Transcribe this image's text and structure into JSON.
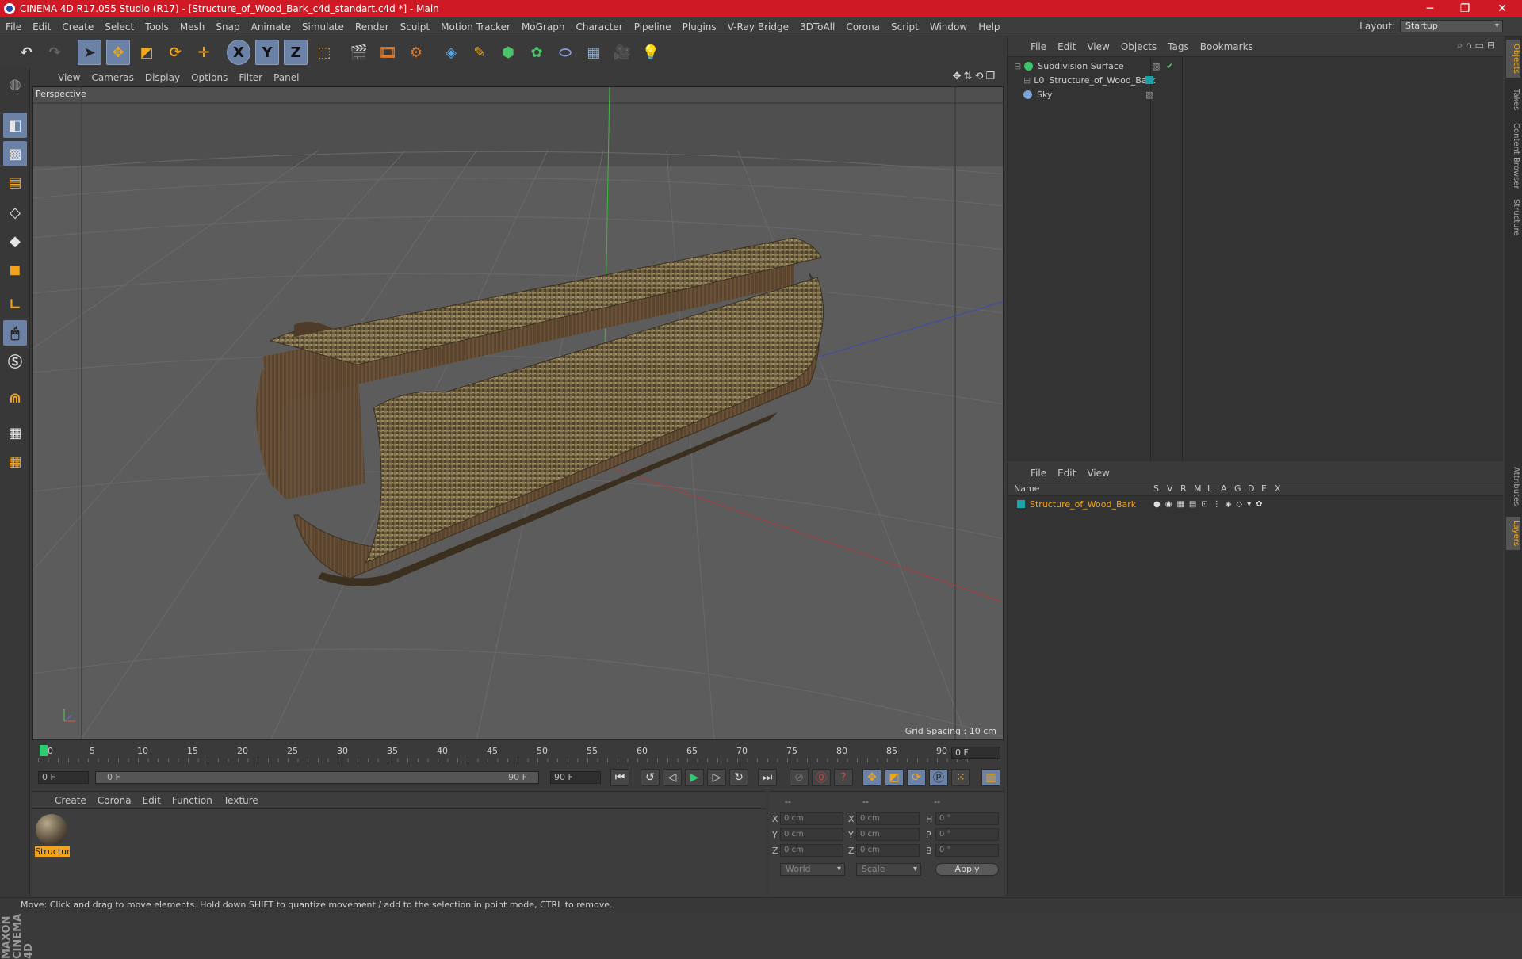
{
  "window": {
    "title": "CINEMA 4D R17.055 Studio (R17) - [Structure_of_Wood_Bark_c4d_standart.c4d *] - Main",
    "minimize": "─",
    "maximize": "❐",
    "close": "✕"
  },
  "menubar": {
    "items": [
      "File",
      "Edit",
      "Create",
      "Select",
      "Tools",
      "Mesh",
      "Snap",
      "Animate",
      "Simulate",
      "Render",
      "Sculpt",
      "Motion Tracker",
      "MoGraph",
      "Character",
      "Pipeline",
      "Plugins",
      "V-Ray Bridge",
      "3DToAll",
      "Corona",
      "Script",
      "Window",
      "Help"
    ],
    "layout_label": "Layout:",
    "layout_value": "Startup"
  },
  "toolbar": {
    "icons": [
      "undo-icon",
      "redo-icon",
      "select-arrow-icon",
      "move-icon",
      "scale-icon",
      "rotate-icon",
      "live-select-icon",
      "x-axis-icon",
      "y-axis-icon",
      "z-axis-icon",
      "coordinate-system-icon",
      "render-view-icon",
      "render-picture-viewer-icon",
      "render-settings-icon",
      "cube-icon",
      "pen-spline-icon",
      "subdivision-icon",
      "cloner-icon",
      "deformer-icon",
      "floor-icon",
      "camera-icon",
      "light-icon"
    ],
    "x_label": "X",
    "y_label": "Y",
    "z_label": "Z"
  },
  "viewport": {
    "menu": [
      "View",
      "Cameras",
      "Display",
      "Options",
      "Filter",
      "Panel"
    ],
    "label": "Perspective",
    "grid_spacing": "Grid Spacing : 10 cm"
  },
  "timeline": {
    "ticks": [
      "0",
      "5",
      "10",
      "15",
      "20",
      "25",
      "30",
      "35",
      "40",
      "45",
      "50",
      "55",
      "60",
      "65",
      "70",
      "75",
      "80",
      "85",
      "90"
    ],
    "current_frame": "0 F",
    "start": "0 F",
    "slider_start": "0 F",
    "slider_end": "90 F",
    "end": "90 F"
  },
  "material_manager": {
    "menu": [
      "Create",
      "Corona",
      "Edit",
      "Function",
      "Texture"
    ],
    "material_name": "Structur"
  },
  "coordinates": {
    "headers": [
      "--",
      "--",
      "--"
    ],
    "rows": [
      {
        "a": "X",
        "av": "0 cm",
        "b": "X",
        "bv": "0 cm",
        "c": "H",
        "cv": "0 °"
      },
      {
        "a": "Y",
        "av": "0 cm",
        "b": "Y",
        "bv": "0 cm",
        "c": "P",
        "cv": "0 °"
      },
      {
        "a": "Z",
        "av": "0 cm",
        "b": "Z",
        "bv": "0 cm",
        "c": "B",
        "cv": "0 °"
      }
    ],
    "mode1": "World",
    "mode2": "Scale",
    "apply": "Apply"
  },
  "object_manager": {
    "menu": [
      "File",
      "Edit",
      "View",
      "Objects",
      "Tags",
      "Bookmarks"
    ],
    "objects": [
      {
        "name": "Subdivision Surface",
        "color": "#3bc46a"
      },
      {
        "name": "Structure_of_Wood_Bark",
        "color": "#3aa3c9"
      },
      {
        "name": "Sky",
        "color": "#7aa3d8"
      }
    ]
  },
  "layer_manager": {
    "menu": [
      "File",
      "Edit",
      "View"
    ],
    "columns": [
      "Name",
      "S",
      "V",
      "R",
      "M",
      "L",
      "A",
      "G",
      "D",
      "E",
      "X"
    ],
    "layer_name": "Structure_of_Wood_Bark",
    "layer_color": "#1aa3a8"
  },
  "side_tabs": [
    "Objects",
    "Takes",
    "Content Browser",
    "Structure",
    "Attributes",
    "Layers"
  ],
  "status": "Move: Click and drag to move elements. Hold down SHIFT to quantize movement / add to the selection in point mode, CTRL to remove.",
  "brand": "MAXON CINEMA 4D",
  "colors": {
    "accent": "#6b82a6",
    "title_bar": "#cf1a26",
    "selection": "#f2a51a"
  }
}
